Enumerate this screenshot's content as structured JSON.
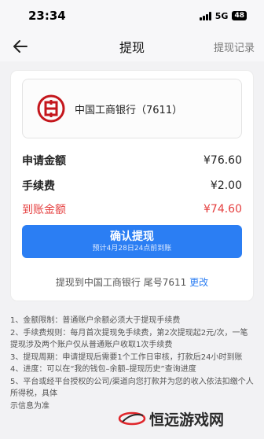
{
  "status_bar": {
    "time": "23:34",
    "network": "5G",
    "battery": "48"
  },
  "nav": {
    "title": "提现",
    "right_link": "提现记录"
  },
  "bank": {
    "name": "中国工商银行（7611）"
  },
  "amounts": {
    "apply_label": "申请金额",
    "apply_value": "¥76.60",
    "fee_label": "手续费",
    "fee_value": "¥2.00",
    "arrive_label": "到账金额",
    "arrive_value": "¥74.60"
  },
  "confirm": {
    "label": "确认提现",
    "sublabel": "预计4月28日24点前到账"
  },
  "account_line": {
    "text": "提现到中国工商银行  尾号7611 ",
    "change": "更改"
  },
  "rules": [
    "1、金额限制：普通账户余额必须大于提现手续费",
    "2、手续费规则：每月首次提现免手续费，第2次提现起2元/次，一笔提现涉及两个账户仅从普通账户收取1次手续费",
    "3、提现周期：申请提现后需要1个工作日审核，打款后24小时到账",
    "4、进度：可以在“我的钱包–余额–提现历史”查询进度",
    "5、平台或经平台授权的公司/渠道向您打款并为您的收入依法扣缴个人所得税，具体",
    "示信息为准"
  ],
  "watermark": {
    "text": "恒远游戏网"
  },
  "colors": {
    "accent": "#2b7ef3",
    "alert": "#e54040",
    "bank_red": "#c4161c"
  }
}
